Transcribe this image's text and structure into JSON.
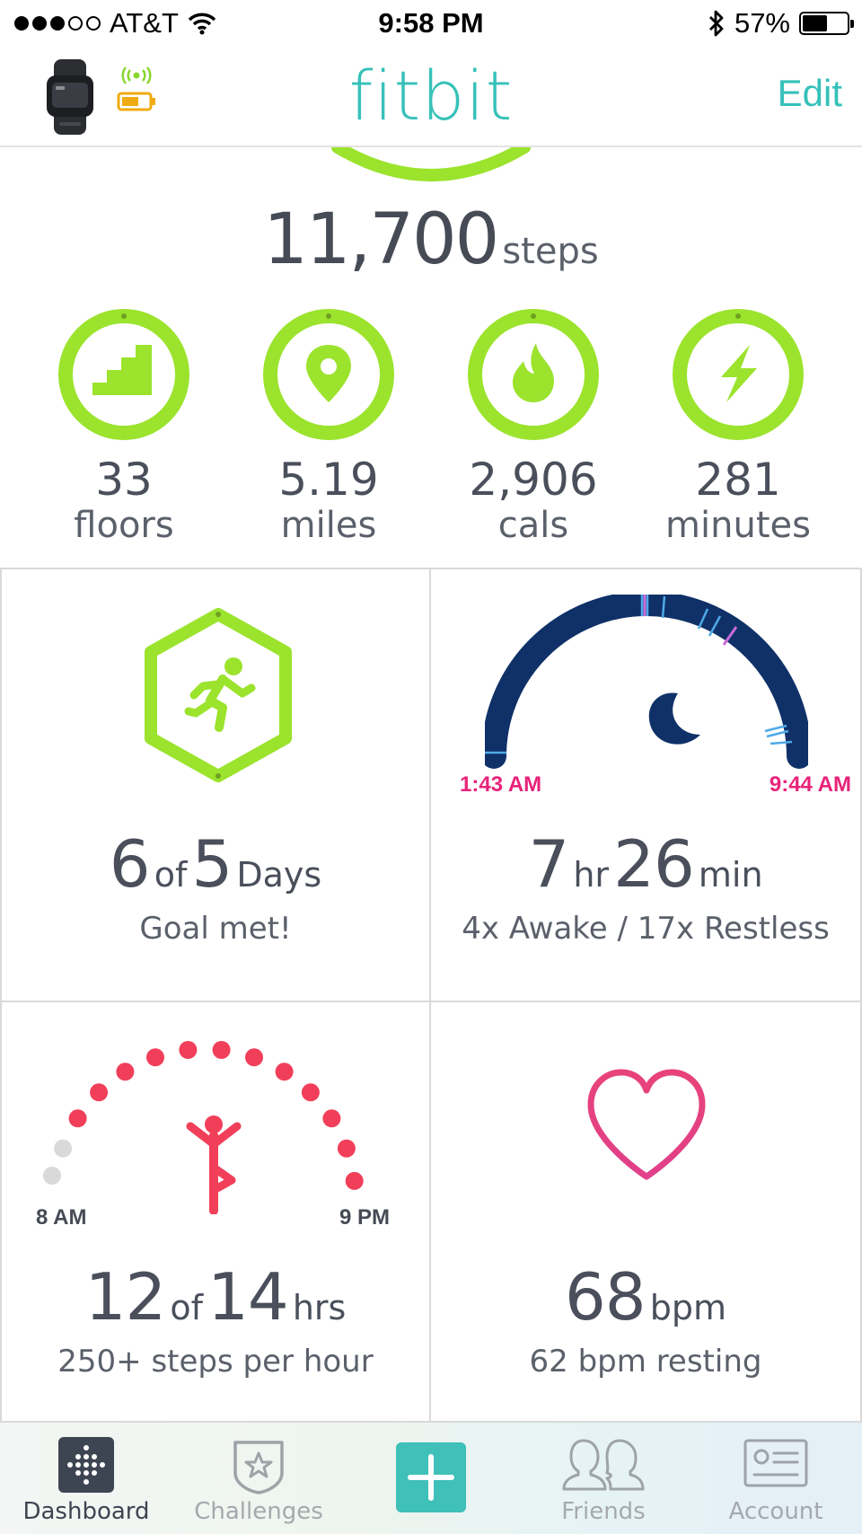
{
  "status_bar": {
    "carrier": "AT&T",
    "time": "9:58 PM",
    "battery": "57%",
    "battery_level": 0.57
  },
  "header": {
    "title": "fitbit",
    "edit_label": "Edit"
  },
  "steps": {
    "value": "11,700",
    "unit": "steps"
  },
  "stats": [
    {
      "value": "33",
      "unit": "floors",
      "icon": "stairs-icon"
    },
    {
      "value": "5.19",
      "unit": "miles",
      "icon": "location-pin-icon"
    },
    {
      "value": "2,906",
      "unit": "cals",
      "icon": "flame-icon"
    },
    {
      "value": "281",
      "unit": "minutes",
      "icon": "lightning-icon"
    }
  ],
  "exercise": {
    "value": "6",
    "of": "of",
    "goal": "5",
    "unit": "Days",
    "sub": "Goal met!"
  },
  "sleep": {
    "start": "1:43 AM",
    "end": "9:44 AM",
    "hours": "7",
    "hr_unit": "hr",
    "minutes": "26",
    "min_unit": "min",
    "sub": "4x Awake / 17x Restless"
  },
  "hourly": {
    "value": "12",
    "of": "of",
    "goal": "14",
    "unit": "hrs",
    "sub": "250+ steps per hour",
    "start_label": "8 AM",
    "end_label": "9 PM"
  },
  "heart": {
    "value": "68",
    "unit": "bpm",
    "sub": "62 bpm resting"
  },
  "tabs": [
    {
      "label": "Dashboard",
      "icon": "dashboard-icon",
      "active": true
    },
    {
      "label": "Challenges",
      "icon": "star-badge-icon",
      "active": false
    },
    {
      "label": "",
      "icon": "plus-icon",
      "active": false
    },
    {
      "label": "Friends",
      "icon": "friends-icon",
      "active": false
    },
    {
      "label": "Account",
      "icon": "account-card-icon",
      "active": false
    }
  ],
  "colors": {
    "accent": "#36c1b9",
    "goal_green": "#9be32d",
    "sleep_navy": "#0f3168",
    "sleep_pink": "#e8237a",
    "hourly_red": "#f13f5a",
    "heart_pink": "#e73e78"
  }
}
